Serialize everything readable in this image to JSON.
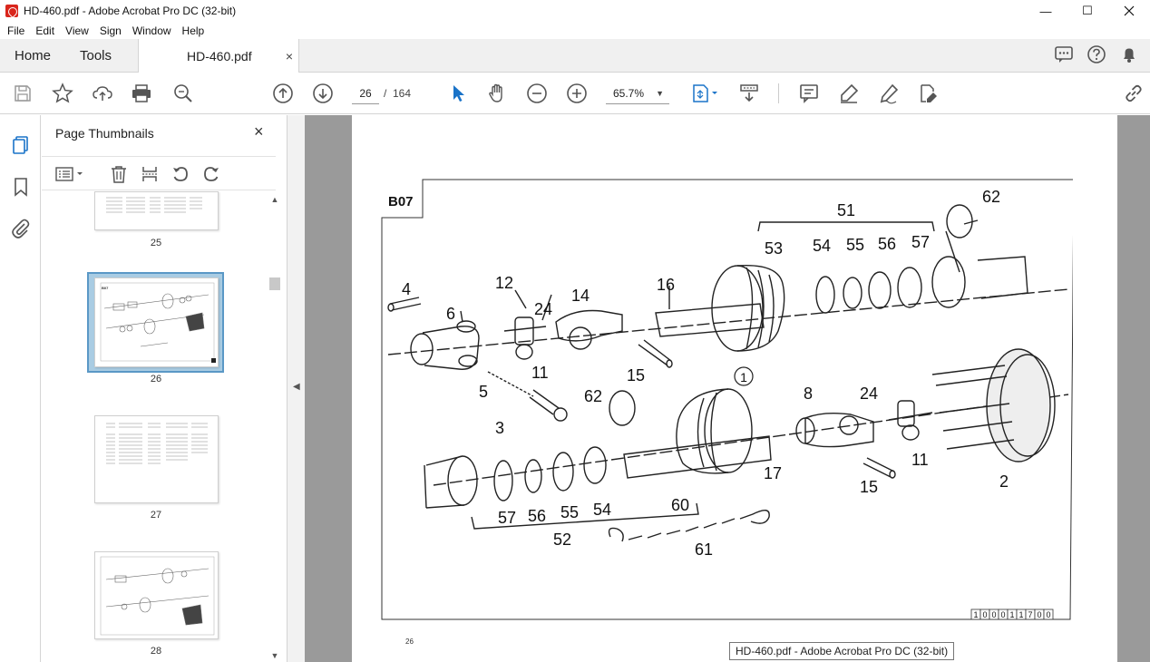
{
  "window": {
    "title": "HD-460.pdf - Adobe Acrobat Pro DC (32-bit)",
    "minimize_glyph": "—",
    "maximize_glyph": "☐"
  },
  "menu": [
    "File",
    "Edit",
    "View",
    "Sign",
    "Window",
    "Help"
  ],
  "tabs": {
    "home": "Home",
    "tools": "Tools",
    "document": "HD-460.pdf",
    "close_glyph": "×"
  },
  "toolbar": {
    "current_page": "26",
    "page_separator": "/",
    "total_pages": "164",
    "zoom": "65.7%"
  },
  "thumbnails": {
    "panel_title": "Page Thumbnails",
    "close_glyph": "×",
    "pages": [
      {
        "label": "25"
      },
      {
        "label": "26",
        "selected": true
      },
      {
        "label": "27"
      },
      {
        "label": "28"
      }
    ]
  },
  "page": {
    "section": "B07",
    "footer_number": "26",
    "part_code_digits": [
      "1",
      "0",
      "0",
      "0",
      "1",
      "1",
      "7",
      "0",
      "0"
    ],
    "callouts_upper": [
      "62",
      "51",
      "53",
      "54",
      "55",
      "56",
      "57",
      "4",
      "12",
      "24",
      "14",
      "16",
      "6",
      "11",
      "15",
      "5",
      "3",
      "62"
    ],
    "callouts_lower": [
      "8",
      "24",
      "11",
      "15",
      "2",
      "17",
      "60",
      "57",
      "56",
      "55",
      "54",
      "52",
      "61"
    ],
    "circled_label": "1"
  },
  "tooltip": "HD-460.pdf - Adobe Acrobat Pro DC (32-bit)",
  "colors": {
    "accent": "#1a73c8",
    "app_red": "#d9261c",
    "doc_bg": "#9a9a9a",
    "selection": "#a9cce3"
  },
  "icons": {
    "save": "save-icon",
    "bookmark_star": "star-icon",
    "upload": "upload-icon",
    "print": "print-icon",
    "find": "search-zoom-icon",
    "page_up": "arrow-up-circle-icon",
    "page_down": "arrow-down-circle-icon",
    "select": "pointer-arrow-icon",
    "hand": "hand-icon",
    "zoom_out": "zoom-out-icon",
    "zoom_in": "zoom-in-icon"
  }
}
